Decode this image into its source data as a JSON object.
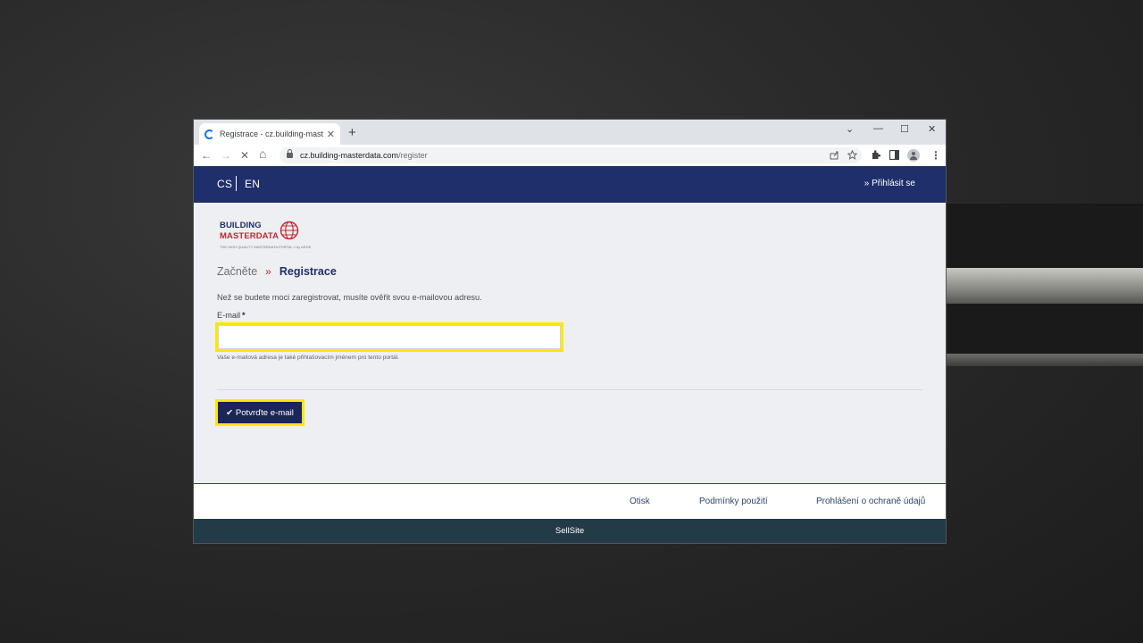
{
  "browser": {
    "tab_title": "Registrace - cz.building-masterdata.com/register",
    "tab_close_glyph": "✕",
    "new_tab_glyph": "+",
    "window_controls": [
      "⌄",
      "—",
      "☐",
      "✕"
    ],
    "nav": {
      "back": "←",
      "forward": "→",
      "stop": "✕",
      "home": "⌂"
    },
    "url_host": "cz.building-masterdata.com",
    "url_path": "/register",
    "toolbar_icons": [
      "share-icon",
      "star-icon",
      "extensions-icon",
      "side-panel-icon",
      "profile-icon",
      "menu-icon"
    ]
  },
  "header": {
    "lang_cs": "CS",
    "lang_en": "EN",
    "login": "» Přihlásit se",
    "color": "#1f2f6b"
  },
  "logo": {
    "line1": "BUILDING",
    "line2": "MASTERDATA",
    "tagline": "THE HIGH QUALITY MASTERDATA PORTAL // by ARGE"
  },
  "breadcrumb": {
    "step1": "Začněte",
    "sep": "»",
    "step2": "Registrace"
  },
  "form": {
    "intro": "Než se budete moci zaregistrovat, musíte ověřit svou e-mailovou adresu.",
    "email_label": "E-mail",
    "required_mark": "*",
    "email_value": "",
    "hint": "Vaše e-mailová adresa je také přihlašovacím jménem pro tento portál.",
    "confirm_label": "✔ Potvrďte e-mail",
    "highlight_color": "#fde800"
  },
  "footer": {
    "links": [
      "Otisk",
      "Podmínky použití",
      "Prohlášení o ochraně údajů"
    ],
    "brand": "SellSite"
  }
}
